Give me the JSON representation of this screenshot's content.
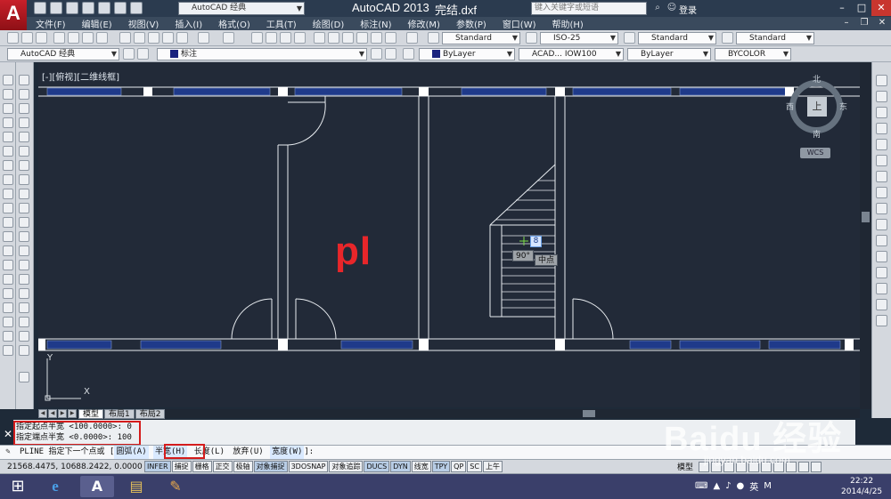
{
  "titlebar": {
    "app_logo": "A",
    "workspace": "AutoCAD 经典",
    "app_title": "AutoCAD 2013",
    "file_name": "完结.dxf",
    "search_placeholder": "键入关键字或短语",
    "login": "登录"
  },
  "menubar": {
    "items": [
      "文件(F)",
      "编辑(E)",
      "视图(V)",
      "插入(I)",
      "格式(O)",
      "工具(T)",
      "绘图(D)",
      "标注(N)",
      "修改(M)",
      "参数(P)",
      "窗口(W)",
      "帮助(H)"
    ]
  },
  "toolbar1": {
    "text_style": "Standard",
    "dim_style": "ISO-25",
    "table_style": "Standard",
    "multileader_style": "Standard"
  },
  "toolbar2": {
    "workspace": "AutoCAD 经典",
    "layer": "标注",
    "color": "ByLayer",
    "linetype": "ACAD... IOW100",
    "lineweight": "ByLayer",
    "plotstyle": "BYCOLOR"
  },
  "viewport": {
    "label": "[-][俯视][二维线框]"
  },
  "viewcube": {
    "north": "北",
    "south": "南",
    "east": "东",
    "west": "西",
    "face": "上",
    "wcs": "WCS"
  },
  "overlay": {
    "pl": "pl"
  },
  "tooltips": {
    "angle": "90°",
    "snap": "中点",
    "input": "8"
  },
  "ucs": {
    "x": "X",
    "y": "Y"
  },
  "tabs": [
    "模型",
    "布局1",
    "布局2"
  ],
  "command": {
    "history": [
      "指定起点半宽 <100.0000>: 0",
      "指定端点半宽 <0.0000>: 100"
    ],
    "prompt": "PLINE 指定下一个点或 [",
    "options": [
      "圆弧(A)",
      "半宽(H)",
      "长度(L)",
      "放弃(U)",
      "宽度(W)"
    ],
    "suffix": "]:"
  },
  "statusbar": {
    "coords": "21568.4475, 10688.2422, 0.0000",
    "buttons": [
      "INFER",
      "捕捉",
      "栅格",
      "正交",
      "极轴",
      "对象捕捉",
      "3DOSNAP",
      "对象追踪",
      "DUCS",
      "DYN",
      "线宽",
      "TPY",
      "QP",
      "SC",
      "上午"
    ],
    "mode": "模型"
  },
  "taskbar": {
    "ime": "英",
    "time": "22:22",
    "date": "2014/4/25"
  },
  "watermark": {
    "brand": "Baidu 经验",
    "url": "jingyan.baidu.com"
  }
}
